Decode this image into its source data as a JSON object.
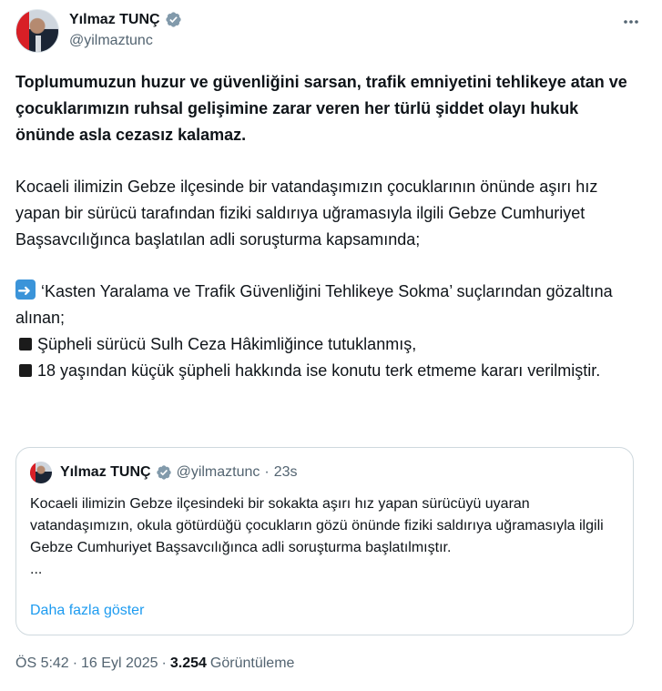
{
  "author": {
    "name": "Yılmaz TUNÇ",
    "handle": "@yilmaztunc",
    "verified_badge_icon": "verified-badge-icon",
    "badge_color": "#829aab"
  },
  "menu_icon": "more-options-icon",
  "tweet": {
    "lead": "Toplumumuzun huzur ve güvenliğini sarsan, trafik emniyetini tehlikeye atan ve çocuklarımızın ruhsal gelişimine zarar veren her türlü şiddet olayı hukuk önünde asla cezasız kalamaz.",
    "paragraph1": "Kocaeli ilimizin Gebze ilçesinde bir vatandaşımızın çocuklarının önünde aşırı hız yapan bir sürücü tarafından fiziki saldırıya uğramasıyla ilgili Gebze Cumhuriyet Başsavcılığınca başlatılan adli soruşturma kapsamında;",
    "item_arrow": "‘Kasten Yaralama ve Trafik Güvenliğini Tehlikeye Sokma’ suçlarından gözaltına alınan;",
    "item_square1": "Şüpheli sürücü Sulh Ceza Hâkimliğince tutuklanmış,",
    "item_square2": "18 yaşından küçük şüpheli hakkında ise konutu terk etmeme kararı verilmiştir."
  },
  "quote": {
    "name": "Yılmaz TUNÇ",
    "handle": "@yilmaztunc",
    "separator": "·",
    "time": "23s",
    "text": "Kocaeli ilimizin Gebze ilçesindeki bir sokakta aşırı hız yapan sürücüyü uyaran vatandaşımızın, okula götürdüğü çocukların gözü önünde fiziki saldırıya uğramasıyla ilgili Gebze Cumhuriyet Başsavcılığınca adli soruşturma başlatılmıştır.",
    "ellipsis": "...",
    "show_more": "Daha fazla göster"
  },
  "meta": {
    "time": "ÖS 5:42",
    "sep1": "·",
    "date": "16 Eyl 2025",
    "sep2": "·",
    "views_count": "3.254",
    "views_label": "Görüntüleme"
  },
  "colors": {
    "text": "#0f1419",
    "secondary": "#536471",
    "link": "#1d9bf0",
    "border": "#cfd9de"
  }
}
